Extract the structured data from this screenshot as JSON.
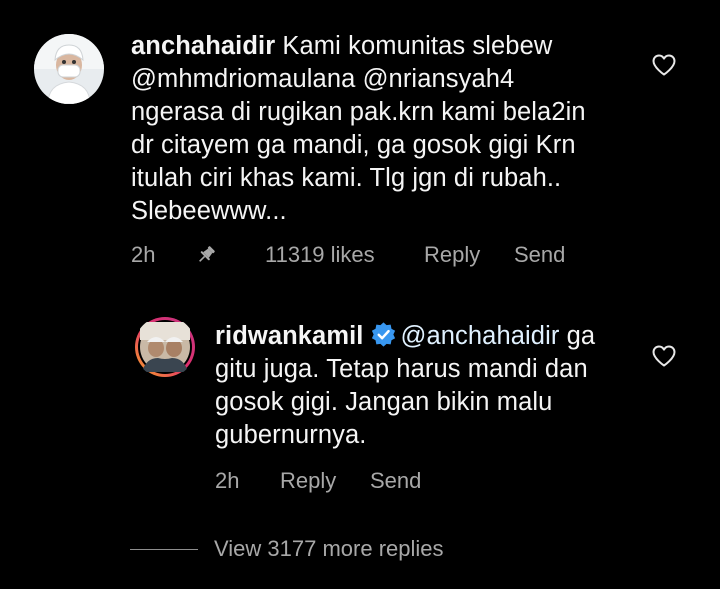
{
  "comment": {
    "username": "anchahaidir",
    "lines": [
      "Kami komunitas slebew",
      "@mhmdriomaulana @nriansyah4",
      "ngerasa di rugikan pak.krn kami bela2in",
      "dr citayem ga mandi, ga gosok gigi Krn",
      "itulah ciri khas kami. Tlg jgn di rubah..",
      "Slebeewww..."
    ],
    "time": "2h",
    "likes": "11319 likes",
    "reply_label": "Reply",
    "send_label": "Send"
  },
  "reply": {
    "username": "ridwankamil",
    "mention": "@anchahaidir",
    "lines": [
      "ga",
      "gitu juga. Tetap harus mandi dan",
      "gosok gigi. Jangan bikin malu",
      "gubernurnya."
    ],
    "time": "2h",
    "reply_label": "Reply",
    "send_label": "Send"
  },
  "more_replies_label": "View 3177 more replies",
  "colors": {
    "background": "#000000",
    "text": "#f5f5f5",
    "secondary": "#a8a8a8",
    "verified": "#3897f0"
  },
  "icons": {
    "like": "heart-outline-icon",
    "pin": "pin-icon",
    "verified": "verified-badge-icon"
  }
}
